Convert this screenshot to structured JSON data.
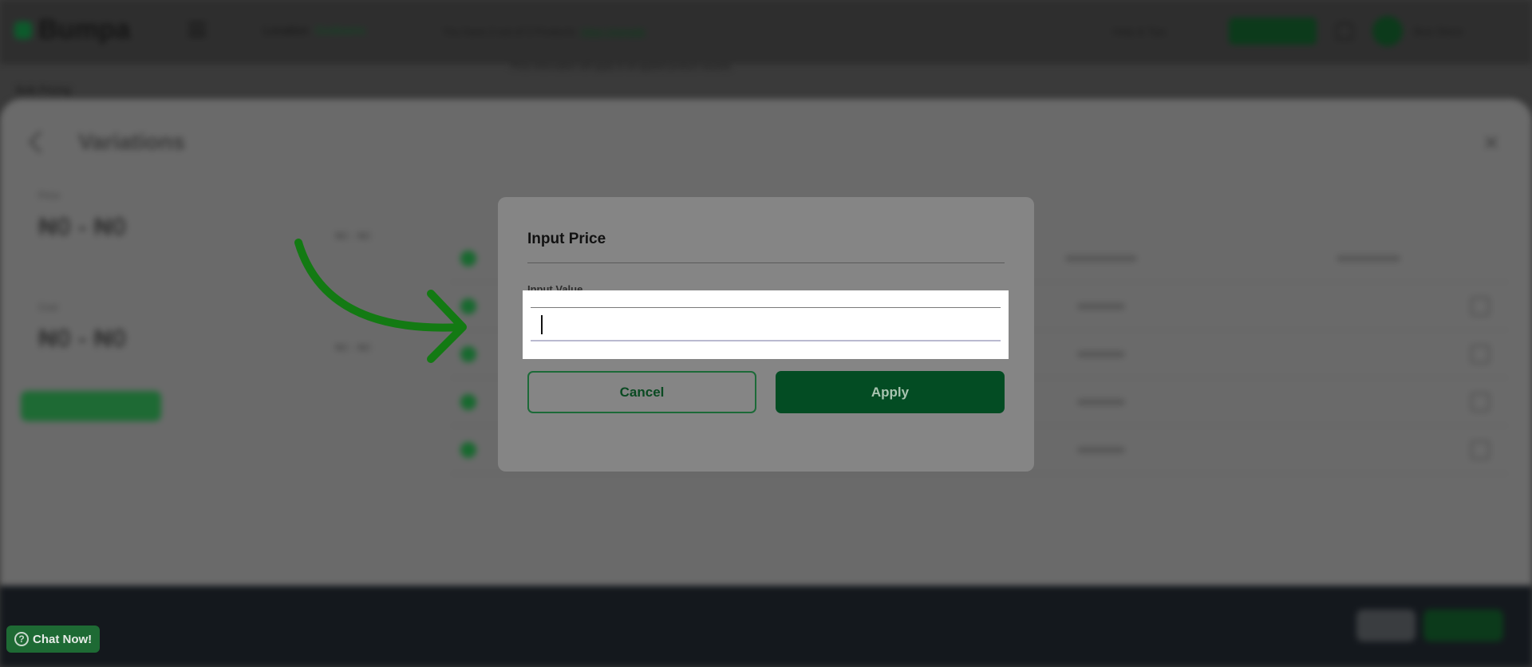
{
  "app": {
    "logo_text": "Bumpa",
    "location_label": "Location",
    "location_value": "Godowns",
    "notice_text": "You have 2 out of 3 Products",
    "notice_link": "View Upgrade",
    "help_text": "Help & Tips",
    "user_name": "Bus Store",
    "sub_notice": "Price information will apply to all applied product variants",
    "breadcrumb": "Bulk Pricing"
  },
  "panel": {
    "title": "Variations",
    "stats": [
      {
        "label": "Price",
        "value": "₦0 - ₦0",
        "side": "₦0 - ₦0"
      },
      {
        "label": "Cost",
        "value": "₦0 - ₦0",
        "side": "₦0 - ₦0"
      }
    ]
  },
  "modal": {
    "title": "Input Price",
    "field_label": "Input Value",
    "input_value": "",
    "cancel_label": "Cancel",
    "apply_label": "Apply"
  },
  "chat": {
    "label": "Chat Now!"
  },
  "colors": {
    "brand_green": "#034c23",
    "accent_green": "#1e6a34",
    "annotation_arrow": "#137a13"
  }
}
